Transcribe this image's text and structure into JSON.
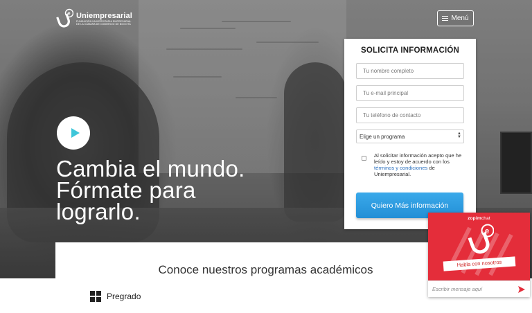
{
  "header": {
    "logo_name": "Uniempresarial",
    "logo_subtitle_line1": "FUNDACIÓN UNIVERSITARIA EMPRESARIAL",
    "logo_subtitle_line2": "DE LA CÁMARA DE COMERCIO DE BOGOTÁ",
    "menu_label": "Menú"
  },
  "hero": {
    "headline_line1": "Cambia el mundo.",
    "headline_line2": "Fórmate para",
    "headline_line3": "lograrlo."
  },
  "form": {
    "title": "SOLICITA INFORMACIÓN",
    "name_placeholder": "Tu nombre completo",
    "email_placeholder": "Tu e-mail principal",
    "phone_placeholder": "Tu teléfono de contacto",
    "program_select_value": "Elige un programa",
    "consent_text_before": "Al solicitar información acepto que he leído y estoy de acuerdo con los ",
    "consent_link": "términos y condiciones",
    "consent_text_after": " de Uniempresarial.",
    "submit_label": "Quiero Más información"
  },
  "programs": {
    "title": "Conoce nuestros programas académicos",
    "pregrado_label": "Pregrado"
  },
  "chat": {
    "brand_prefix": "zopim",
    "brand_suffix": "chat",
    "cta_label": "Habla con nosotros",
    "input_placeholder": "Escribir mensaje aquí"
  },
  "colors": {
    "accent_blue": "#238fd6",
    "chat_red": "#e42d3a",
    "play_icon": "#3ec6d9",
    "link_blue": "#2a6fbe"
  },
  "icons": {
    "play": "play-icon",
    "menu": "hamburger-icon",
    "grid": "grid-icon",
    "send": "send-icon"
  }
}
